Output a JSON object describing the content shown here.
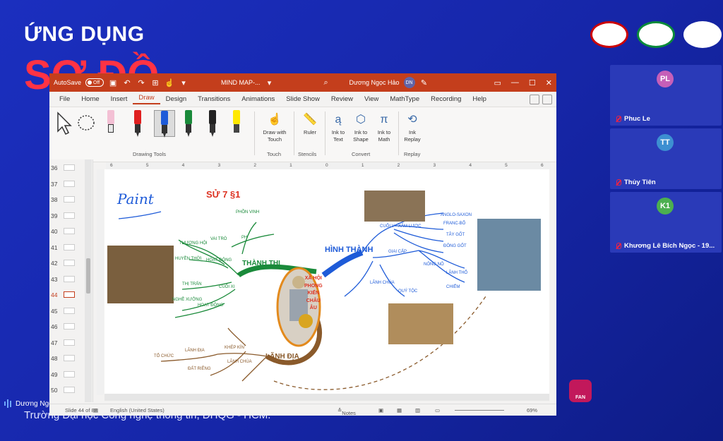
{
  "background": {
    "title": "ỨNG DỤNG",
    "big_text": "SƠ ĐỒ",
    "footer": "Trường Đại học Công nghệ thông tin, ĐHQG - HCM."
  },
  "participants": [
    {
      "initials": "PL",
      "name": "Phuc Le",
      "color": "#c65fb8"
    },
    {
      "initials": "TT",
      "name": "Thủy Tiên",
      "color": "#3d8fd1"
    },
    {
      "initials": "K1",
      "name": "Khương Lê Bích Ngọc - 19...",
      "color": "#4caf50"
    }
  ],
  "speaker": {
    "name": "Dương Ngọc Hảo"
  },
  "fpt_label": "FAN",
  "ppt": {
    "autosave_label": "AutoSave",
    "autosave_state": "Off",
    "doc_title": "MIND MAP-...",
    "user_name": "Dương Ngọc Hảo",
    "user_initials": "DN",
    "menu": [
      "File",
      "Home",
      "Insert",
      "Draw",
      "Design",
      "Transitions",
      "Animations",
      "Slide Show",
      "Review",
      "View",
      "MathType",
      "Recording",
      "Help"
    ],
    "active_menu": "Draw",
    "ribbon": {
      "drawing_tools": "Drawing Tools",
      "draw_with_touch": "Draw with Touch",
      "touch": "Touch",
      "ruler": "Ruler",
      "stencils": "Stencils",
      "ink_to_text": "Ink to Text",
      "ink_to_shape": "Ink to Shape",
      "ink_to_math": "Ink to Math",
      "convert": "Convert",
      "ink_replay": "Ink Replay",
      "replay": "Replay"
    },
    "thumbnails": [
      "36",
      "37",
      "38",
      "39",
      "40",
      "41",
      "42",
      "43",
      "44",
      "45",
      "46",
      "47",
      "48",
      "49",
      "50"
    ],
    "selected_thumb": "44",
    "ruler_labels": [
      "6",
      "5",
      "4",
      "3",
      "2",
      "1",
      "0",
      "1",
      "2",
      "3",
      "4",
      "5",
      "6"
    ],
    "status": {
      "slide": "Slide 44 of 88",
      "language": "English (United States)",
      "notes": "Notes",
      "zoom": "69%"
    }
  },
  "mindmap": {
    "paint": "Paint",
    "su": "SỬ 7 §1",
    "center": [
      "XÃ HỘI",
      "PHONG",
      "KIẾN",
      "CHÂU",
      "ÂU"
    ],
    "thanh_thi": "THÀNH THỊ",
    "hinh_thanh": "HÌNH THÀNH",
    "lanh_dia": "LÃNH ĐỊA",
    "left_branches": [
      "PHỒN VINH",
      "THƯƠNG HỘI",
      "VAI TRÒ",
      "PH",
      "HOẠT ĐỘNG",
      "HUYỀN THỜI",
      "THỊ TRẤN",
      "CUỐI XI",
      "NGHỀ XƯỞNG",
      "HOẠT ĐỘNG"
    ],
    "right_branches": [
      "CUỐI V",
      "XÂM LƯỢC",
      "ANGLO-SAXON",
      "FRANC-BỐ",
      "TÂY GỐT",
      "ĐÔNG GỐT",
      "GIAI CẤP",
      "NÔNG NÔ",
      "LÃNH CHÚA",
      "QUÝ TỘC",
      "LÃNH THỔ",
      "CHIẾM"
    ],
    "bottom_branches": [
      "TỔ CHỨC",
      "LÃNH ĐỊA",
      "KHÉP KÍN",
      "LÃNH CHÚA",
      "ĐẤT RIÊNG"
    ]
  }
}
